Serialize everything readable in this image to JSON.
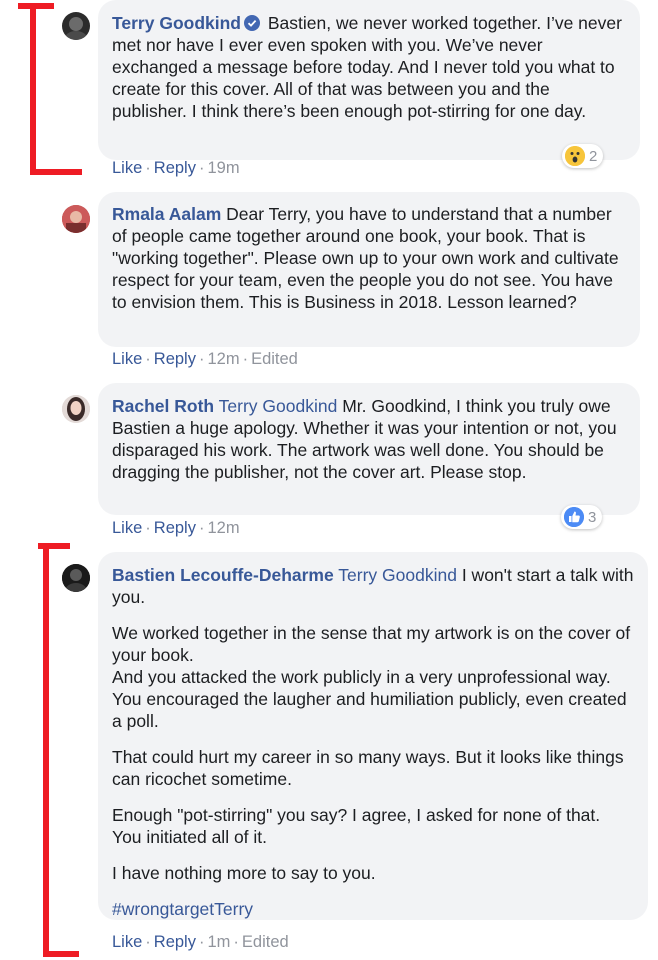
{
  "comments": [
    {
      "name": "Terry Goodkind",
      "text": "Bastien, we never worked together. I’ve never met nor have I ever even spoken with you. We’ve never exchanged a message before today. And I never told you what to create for this cover. All of that was between you and the publisher. I think there’s been enough pot-stirring for one day.",
      "like": "Like",
      "reply": "Reply",
      "time": "19m",
      "reaction_count": "2",
      "reaction_icon": "wow-emoji-icon"
    },
    {
      "name": "Rmala Aalam",
      "text": "Dear Terry, you have to understand that a number of people came together around one book, your book. That is \"working together\". Please own up to your own work and cultivate respect for your team, even the people you do not see. You have to envision them. This is Business in 2018. Lesson learned?",
      "like": "Like",
      "reply": "Reply",
      "time": "12m",
      "edited": "Edited"
    },
    {
      "name": "Rachel Roth",
      "tag": "Terry Goodkind",
      "text": "Mr. Goodkind, I think you truly owe Bastien a huge apology. Whether it was your intention or not, you disparaged his work. The artwork was well done. You should be dragging the publisher, not the cover art. Please stop.",
      "like": "Like",
      "reply": "Reply",
      "time": "12m",
      "reaction_count": "3",
      "reaction_icon": "thumbs-up-icon"
    },
    {
      "name": "Bastien Lecouffe-Deharme",
      "tag": "Terry Goodkind",
      "text": "I won't start a talk with you.",
      "paragraphs": [
        "We worked together in the sense that my artwork is on the cover of your book.",
        "And you attacked the work publicly in a very unprofessional way. You encouraged the laugher and humiliation publicly, even created a poll.",
        "That could hurt my career in so many ways. But it looks like things can ricochet sometime.",
        "Enough \"pot-stirring\" you say? I agree, I asked for none of that. You initiated all of it.",
        "I have nothing more to say to you."
      ],
      "hashtag": "#wrongtargetTerry",
      "like": "Like",
      "reply": "Reply",
      "time": "1m",
      "edited": "Edited"
    }
  ],
  "colors": {
    "name_link": "#385898",
    "bubble_bg": "#f2f3f5",
    "meta_grey": "#90949c",
    "annotation_red": "#ee1c24",
    "verified_blue": "#4267b2"
  }
}
